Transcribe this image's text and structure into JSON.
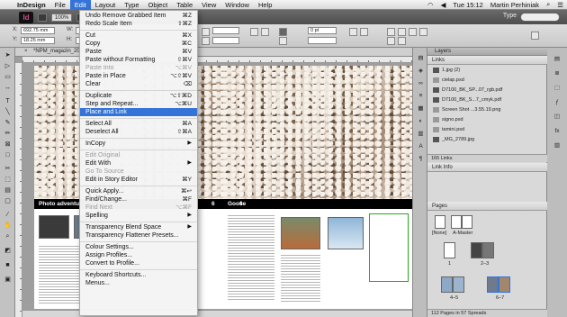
{
  "menubar": {
    "app": "InDesign",
    "items": [
      "File",
      "Edit",
      "Layout",
      "Type",
      "Object",
      "Table",
      "View",
      "Window",
      "Help"
    ],
    "clock": "Tue 15:12",
    "user": "Martin Perhiniak"
  },
  "appbar": {
    "logo": "Id",
    "zoom": "100%",
    "workspace": "Type"
  },
  "control": {
    "x_value": "692.75 mm",
    "y_value": "18.25 mm",
    "x_label": "X:",
    "y_label": "Y:",
    "w_label": "W:",
    "h_label": "H:",
    "stroke_value": "0 pt"
  },
  "document": {
    "tab_title": "*NPM_magazin_2013-",
    "caption_left": "Photo adventu",
    "caption_right": "Goose",
    "page_number_left": "6",
    "page_number_right": "6"
  },
  "edit_menu": {
    "items": [
      {
        "label": "Undo Remove Grabbed Item",
        "shortcut": "⌘Z"
      },
      {
        "label": "Redo Scale Item",
        "shortcut": "⇧⌘Z"
      },
      {
        "sep": true
      },
      {
        "label": "Cut",
        "shortcut": "⌘X"
      },
      {
        "label": "Copy",
        "shortcut": "⌘C"
      },
      {
        "label": "Paste",
        "shortcut": "⌘V"
      },
      {
        "label": "Paste without Formatting",
        "shortcut": "⇧⌘V"
      },
      {
        "label": "Paste Into",
        "shortcut": "⌥⌘V",
        "disabled": true
      },
      {
        "label": "Paste in Place",
        "shortcut": "⌥⇧⌘V"
      },
      {
        "label": "Clear",
        "shortcut": "⌫"
      },
      {
        "sep": true
      },
      {
        "label": "Duplicate",
        "shortcut": "⌥⇧⌘D"
      },
      {
        "label": "Step and Repeat...",
        "shortcut": "⌥⌘U"
      },
      {
        "label": "Place and Link",
        "shortcut": "",
        "highlighted": true
      },
      {
        "sep": true
      },
      {
        "label": "Select All",
        "shortcut": "⌘A"
      },
      {
        "label": "Deselect All",
        "shortcut": "⇧⌘A"
      },
      {
        "sep": true
      },
      {
        "label": "InCopy",
        "submenu": true
      },
      {
        "sep": true
      },
      {
        "label": "Edit Original",
        "disabled": true
      },
      {
        "label": "Edit With",
        "submenu": true
      },
      {
        "label": "Go To Source",
        "disabled": true
      },
      {
        "label": "Edit in Story Editor",
        "shortcut": "⌘Y"
      },
      {
        "sep": true
      },
      {
        "label": "Quick Apply...",
        "shortcut": "⌘↩"
      },
      {
        "label": "Find/Change...",
        "shortcut": "⌘F"
      },
      {
        "label": "Find Next",
        "shortcut": "⌥⌘F",
        "disabled": true
      },
      {
        "label": "Spelling",
        "submenu": true
      },
      {
        "sep": true
      },
      {
        "label": "Transparency Blend Space",
        "submenu": true
      },
      {
        "label": "Transparency Flattener Presets..."
      },
      {
        "sep": true
      },
      {
        "label": "Colour Settings..."
      },
      {
        "label": "Assign Profiles..."
      },
      {
        "label": "Convert to Profile..."
      },
      {
        "sep": true
      },
      {
        "label": "Keyboard Shortcuts..."
      },
      {
        "label": "Menus..."
      }
    ]
  },
  "panels": {
    "layers_tab": "Layers",
    "links_tab": "Links",
    "links": [
      "1.jpg (2)",
      "cielap.psd",
      "D7100_BK_SP...07_rgb.pdf",
      "D7100_BK_S...7_cmyk.pdf",
      "Screen Shot ...3.55.19.png",
      "signo.psd",
      "tamini.psd",
      "_MG_2789.jpg"
    ],
    "links_count": "165 Links",
    "link_info": "Link Info",
    "pages_tab": "Pages",
    "none_label": "[None]",
    "master_label": "A-Master",
    "spread_labels": [
      "1",
      "2–3",
      "4–5",
      "6–7"
    ],
    "pages_footer": "112 Pages in 57 Spreads"
  }
}
